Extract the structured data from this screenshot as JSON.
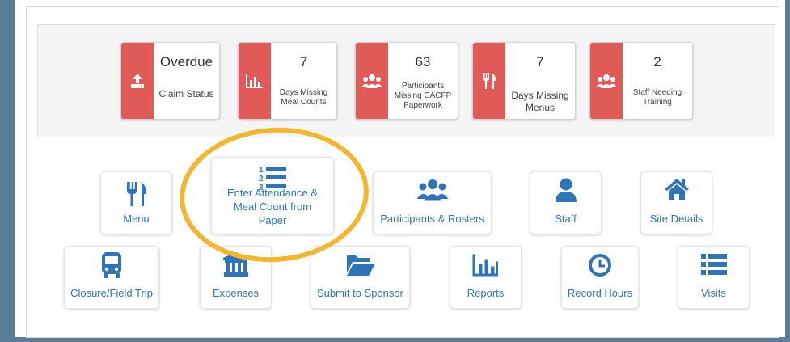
{
  "stats": [
    {
      "value": "Overdue",
      "label": "Claim Status",
      "icon": "upload-icon"
    },
    {
      "value": "7",
      "label": "Days Missing Meal Counts",
      "icon": "bar-chart-icon"
    },
    {
      "value": "63",
      "label": "Participants Missing CACFP Paperwork",
      "icon": "users-icon"
    },
    {
      "value": "7",
      "label": "Days Missing Menus",
      "icon": "utensils-icon"
    },
    {
      "value": "2",
      "label": "Staff Needing Training",
      "icon": "users-icon"
    }
  ],
  "tiles_row1": [
    {
      "label": "Menu",
      "icon": "utensils-icon"
    },
    {
      "label": "Enter Attendance & Meal Count from Paper",
      "icon": "numbered-list-icon"
    },
    {
      "label": "Participants & Rosters",
      "icon": "users-icon"
    },
    {
      "label": "Staff",
      "icon": "user-icon"
    },
    {
      "label": "Site Details",
      "icon": "home-icon"
    }
  ],
  "tiles_row2": [
    {
      "label": "Closure/Field Trip",
      "icon": "bus-icon"
    },
    {
      "label": "Expenses",
      "icon": "bank-icon"
    },
    {
      "label": "Submit to Sponsor",
      "icon": "folder-open-icon"
    },
    {
      "label": "Reports",
      "icon": "bar-chart-icon"
    },
    {
      "label": "Record Hours",
      "icon": "clock-icon"
    },
    {
      "label": "Visits",
      "icon": "list-icon"
    }
  ],
  "colors": {
    "alert_red": "#e05a58",
    "link_blue": "#2f74b7",
    "frame": "#5b7d98",
    "highlight": "#f2b632"
  }
}
